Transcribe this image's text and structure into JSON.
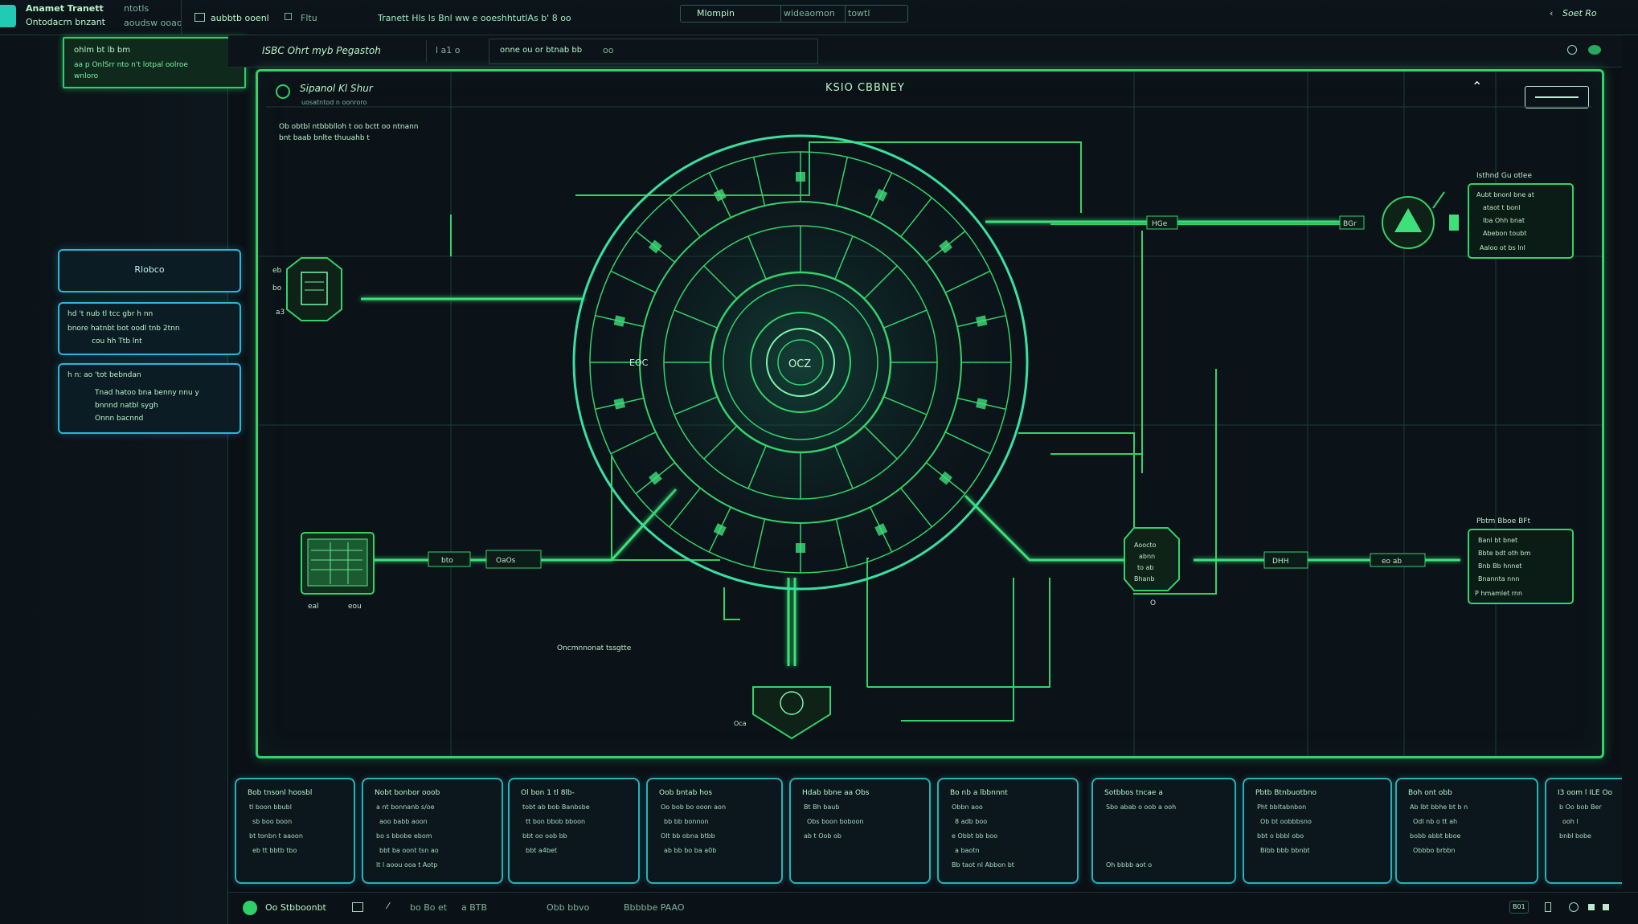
{
  "topbar": {
    "title_line1": "Anamet Tranett",
    "title_line2": "Ontodacrn bnzant",
    "subtitle": "ntotls",
    "subtitle2": "aoudsw ooao",
    "checkbox_label": "aubbtb ooenl",
    "tab2": "Fltu",
    "path_text": "Tranett Hls ls Bnl ww e ooeshhtutlAs b' 8 oo",
    "tab_a": "Mlompin",
    "tab_b": "wideaomon",
    "tab_c": "towtl",
    "right_text": "Soet Ro"
  },
  "leftpanel": {
    "highlight_line1": "ohlm bt lb bm",
    "highlight_line2": "aa p OnlSrr nto n't lotpal oolroe",
    "highlight_line3": "wnloro",
    "btn1_label": "Rlobco",
    "btn2_line1": "hd 't nub tl tcc gbr  h  nn",
    "btn2_line2": "bnore hatnbt bot oodl tnb 2tnn",
    "btn2_line3": "cou hh Ttb  lnt",
    "btn3_line1": "h n: ao 'tot bebndan",
    "btn3_line2": "Tnad hatoo bna benny nnu y",
    "btn3_line3": "bnnnd natbl sygh",
    "btn3_line4": "Onnn bacnnd"
  },
  "header": {
    "title": "ISBC Ohrt myb Pegastoh",
    "field1": "l a1 o",
    "field2": "onne ou or btnab bb",
    "field3": "oo"
  },
  "main": {
    "panel_title": "Sipanol Kl Shur",
    "panel_sub": "uosatntod n oonroro",
    "panel_desc1": "Ob obtbl ntbbblloh t oo bctt oo ntnann",
    "panel_desc2": "bnt baab bnlte thuuahb t",
    "center_title": "KSIO CBBNEY",
    "core_label": "OCZ",
    "ring_label": "EOC",
    "left_node_a": "eb",
    "left_node_b": "bo",
    "left_node_c": "a3",
    "bl_label1": "eal",
    "bl_label2": "eou",
    "bl_chip1": "bto",
    "bl_chip2": "OaOs",
    "top_chip": "HGe",
    "top_chip2": "BGr",
    "bottom_label": "Oncmnnonat tssgtte",
    "bottom_node": "Oca",
    "tr_title": "Isthnd Gu otlee",
    "tr_lines": [
      "Aubt bnonl bne at",
      "ataot t bonl",
      "Iba Ohh bnat",
      "Abebon toubt",
      "Aaloo ot bs lnl"
    ],
    "br_title": "Pbtm Bboe BFt",
    "br_lines": [
      "Banl bt bnet",
      "Bbte bdt oth bm",
      "Bnb Bb hnnet",
      "Bnannta nnn",
      "P hmamlet rnn"
    ],
    "mid_node_lines": [
      "Aoocto",
      "abnn",
      "to ab",
      "Bhanb"
    ],
    "mid_node_below": "O",
    "chip_r1": "DHH",
    "chip_r2": "eo ab"
  },
  "cards": [
    {
      "title": "Bob tnsonl hoosbl",
      "lines": [
        "tl boon bbubl",
        "sb boo boon",
        "bt tonbn t aaoon",
        "eb tt bbtb tbo"
      ]
    },
    {
      "title": "Nobt bonbor ooob",
      "lines": [
        "a nt bonnanb s/oe",
        "aoo babb aoon",
        "bo s bbobe ebom",
        "bbt ba oont tsn ao",
        "lt l aoou ooa t Aotp"
      ]
    },
    {
      "title": "Ol bon 1 tl 8lb-",
      "lines": [
        "tobt ab bob Banbsbe",
        "tt bon bbob bboon",
        "bbt oo oob bb",
        "bbt a4bet"
      ]
    },
    {
      "title": "Oob bntab hos",
      "lines": [
        "Oo bob bo ooon aon",
        "bb bb bonnon",
        "Olt bb obna btbb",
        "ab bb bo ba a0b"
      ]
    },
    {
      "title": "Hdab bbne aa Obs",
      "lines": [
        "Bt Bh baub",
        "Obs boon boboon",
        "ab t  Oob ob"
      ]
    },
    {
      "title": "Bo nb  a lbbnnnt",
      "lines": [
        "Obbn aoo",
        "8 adb boo",
        "e  Obbt bb boo",
        "a  baotn",
        "Bb taot nl Abbon bt"
      ]
    },
    {
      "title": "Sotbbos tncae a",
      "lines": [
        "Sbo abab o oob a ooh",
        "",
        "",
        "",
        "Oh bbbb aot o"
      ]
    },
    {
      "title": "Pbtb Btnbuotbno",
      "lines": [
        "Pht bbltabnbon",
        "Ob bt oobbbsno",
        "bbt o bbbl obo",
        "Bibb bbb bbnbt"
      ]
    },
    {
      "title": "Boh ont obb",
      "lines": [
        "Ab lbt bbhe bt b n",
        "Odl nb o tt ah",
        "bobb abbt bboe",
        "Obbbo brbbn"
      ]
    },
    {
      "title": "I3 oom l ILE Oo",
      "lines": [
        "b Oo bob Ber",
        "ooh l",
        "bnbl bobe"
      ]
    }
  ],
  "bottombar": {
    "item1": "Oo Stbboonbt",
    "item2": "bo Bo et",
    "item3": "a BTB",
    "item4": "Obb bbvo",
    "item5": "Bbbbbe PAAO",
    "right_chip": "B01"
  },
  "colors": {
    "accent_green": "#33d26a",
    "accent_cyan": "#2bb6d6",
    "background": "#0a1016"
  }
}
